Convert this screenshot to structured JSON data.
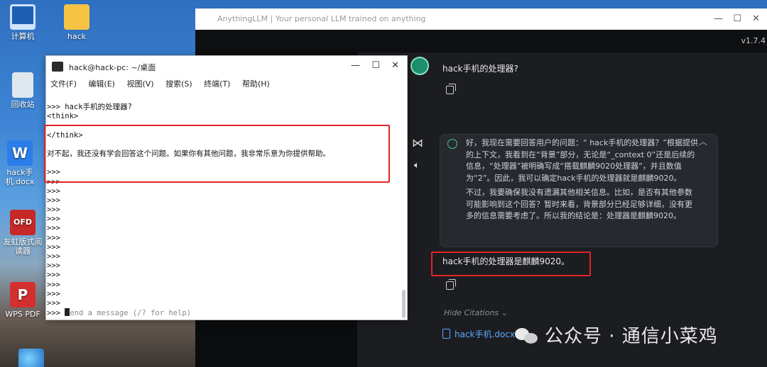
{
  "desktop": {
    "icons": [
      {
        "label": "计算机"
      },
      {
        "label": "hack"
      },
      {
        "label": "回收站"
      },
      {
        "label": "hack手机.docx"
      },
      {
        "label": "友虹版式阅读器"
      },
      {
        "label": "WPS PDF"
      }
    ]
  },
  "anything": {
    "title": "AnythingLLM | Your personal LLM trained on anything",
    "version": "v1.7.4",
    "user_message": "hack手机的处理器?",
    "think_p1": "好，我现在需要回答用户的问题：“ hack手机的处理器？”根据提供的上下文，我看到在“背景”部分，无论是“_context 0”还是后续的信息，“处理器”被明确写成“搭载麒麟9020处理器”，并且数值为“2”。因此，我可以确定hack手机的处理器就是麒麟9020。",
    "think_p2": "不过，我要确保我没有遗漏其他相关信息。比如，是否有其他参数可能影响到这个回答？暂时来看，背景部分已经足够详细，没有更多的信息需要考虑了。所以我的结论是：处理器是麒麟9020。",
    "answer": "hack手机的处理器是麒麟9020。",
    "hide_citations": "Hide Citations",
    "citation_file": "hack手机.docx",
    "watermark": "公众号 · 通信小菜鸡"
  },
  "terminal": {
    "title": "hack@hack-pc: ~/桌面",
    "menu": [
      "文件(F)",
      "编辑(E)",
      "视图(V)",
      "搜索(S)",
      "终端(T)",
      "帮助(H)"
    ],
    "lines": [
      ">>> hack手机的处理器?",
      "<think>",
      "",
      "</think>",
      "",
      "对不起，我还没有学会回答这个问题。如果你有其他问题，我非常乐意为你提供帮助。",
      "",
      ">>>",
      ">>>",
      ">>>",
      ">>>",
      ">>>",
      ">>>",
      ">>>",
      ">>>",
      ">>>",
      ">>>",
      ">>>",
      ">>>",
      ">>>",
      ">>>",
      ">>>"
    ],
    "prompt": ">>> ",
    "placeholder": "end a message (/? for help)",
    "cursor_char": "S"
  },
  "colors": {
    "highlight": "#e02424",
    "accent_green": "#3ecf8e",
    "link": "#5aa9ff"
  }
}
